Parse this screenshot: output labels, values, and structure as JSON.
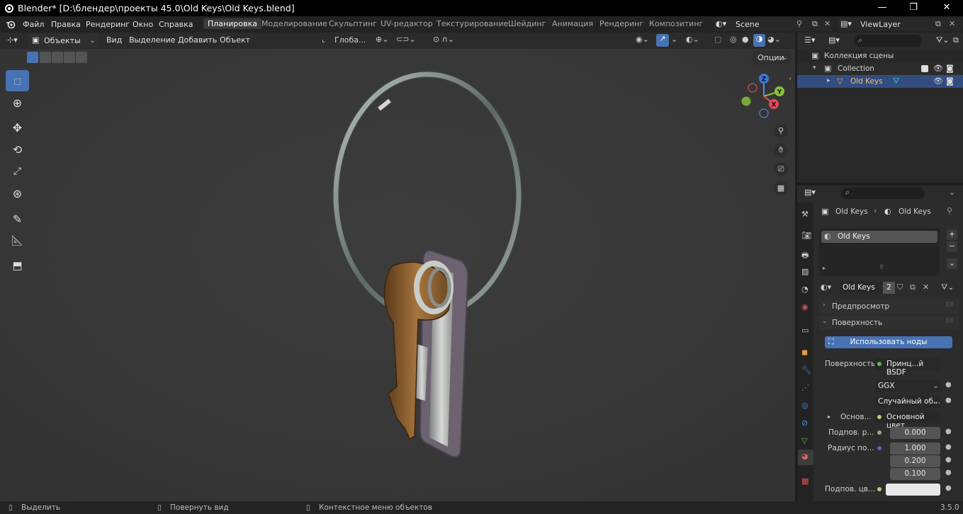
{
  "window": {
    "title": "Blender* [D:\\блендер\\проекты 45.0\\Old Keys\\Old Keys.blend]",
    "minimize": "—",
    "maximize": "❐",
    "close": "✕"
  },
  "menu": [
    "Файл",
    "Правка",
    "Рендеринг",
    "Окно",
    "Справка"
  ],
  "workspaces": [
    "Планировка",
    "Моделирование",
    "Скульптинг",
    "UV-редактор",
    "Текстурирование",
    "Шейдинг",
    "Анимация",
    "Рендеринг",
    "Композитинг"
  ],
  "active_workspace": "Планировка",
  "scene": {
    "label": "Scene"
  },
  "viewlayer": {
    "label": "ViewLayer"
  },
  "viewport_header": {
    "mode": "Объекты",
    "view": "Вид",
    "select": "Выделение",
    "add": "Добавить",
    "object": "Объект",
    "orientation": "Глоба...",
    "options": "Опции"
  },
  "navigation_gizmo": {
    "z": "Z",
    "y": "Y",
    "x": "X"
  },
  "outliner": {
    "scene_collection": "Коллекция сцены",
    "collection": "Collection",
    "object": "Old Keys"
  },
  "properties": {
    "breadcrumb_object": "Old Keys",
    "breadcrumb_material": "Old Keys",
    "slot": "Old Keys",
    "material_name": "Old Keys",
    "users": "2",
    "preview_panel": "Предпросмотр",
    "surface_panel": "Поверхность",
    "use_nodes": "Использовать ноды",
    "surface_label": "Поверхность",
    "surface_value": "Принц...й BSDF",
    "distribution": "GGX",
    "subsurface_method": "Случайный об...",
    "base_label": "Основ...",
    "base_value": "Основной цвет",
    "subsurface_label": "Подпов. р...",
    "subsurface_value": "0.000",
    "radius_label": "Радиус по...",
    "radius_values": [
      "1.000",
      "0.200",
      "0.100"
    ],
    "subsurface_color_label": "Подпов. цв..."
  },
  "statusbar": {
    "select": "Выделить",
    "rotate": "Повернуть вид",
    "context": "Контекстное меню объектов",
    "version": "3.5.0"
  },
  "colors": {
    "accent": "#4772b3",
    "viewport_bg": "#393939",
    "header_bg": "#2b2b2b",
    "panel_bg": "#2c2c2c"
  }
}
